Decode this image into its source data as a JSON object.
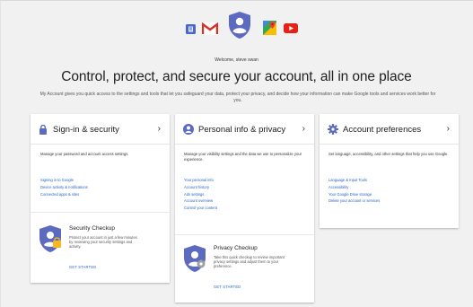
{
  "header": {
    "icons": [
      "google-apps-icon",
      "gmail-icon",
      "account-shield-icon",
      "maps-icon",
      "youtube-icon"
    ],
    "welcome": "Welcome, steve swan",
    "headline": "Control, protect, and secure your account, all in one place",
    "subhead": "My Account gives you quick access to the settings and tools that let you safeguard your data, protect your privacy, and decide how your information can make Google tools and services work better for you."
  },
  "cards": {
    "signin": {
      "title": "Sign-in & security",
      "icon": "lock-icon",
      "description": "Manage your password and account access settings.",
      "links": [
        "Signing in to Google",
        "Device activity & notifications",
        "Connected apps & sites"
      ],
      "checkup": {
        "title": "Security Checkup",
        "description": "Protect your account in just a few minutes by reviewing your security settings and activity.",
        "action": "GET STARTED"
      }
    },
    "personal": {
      "title": "Personal info & privacy",
      "icon": "person-icon",
      "description": "Manage your visibility settings and the data we use to personalize your experience.",
      "links": [
        "Your personal info",
        "Account history",
        "Ads settings",
        "Account overview",
        "Control your content"
      ],
      "checkup": {
        "title": "Privacy Checkup",
        "description": "Take this quick checkup to review important privacy settings and adjust them to your preference.",
        "action": "GET STARTED"
      }
    },
    "preferences": {
      "title": "Account preferences",
      "icon": "gear-icon",
      "description": "Set language, accessibility, and other settings that help you use Google.",
      "links": [
        "Language & Input Tools",
        "Accessibility",
        "Your Google Drive storage",
        "Delete your account or services"
      ]
    }
  },
  "colors": {
    "accent": "#5c6bc0",
    "link": "#2962c6",
    "gmail_red": "#d93025",
    "youtube_red": "#e62117",
    "shield_gold": "#f6b81e"
  }
}
